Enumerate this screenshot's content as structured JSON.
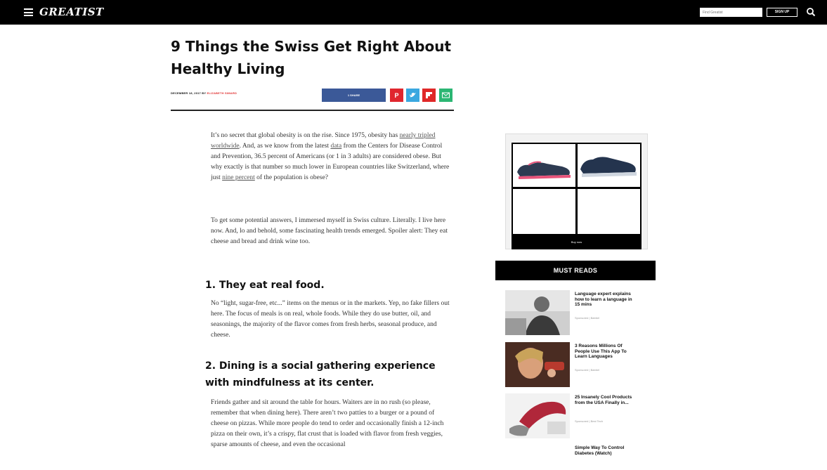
{
  "nav": {
    "logo": "GREATIST",
    "search_placeholder": "Find Greatist",
    "signup_label": "SIGN UP"
  },
  "article": {
    "title": "9 Things the Swiss Get Right About Healthy Living",
    "date": "DECEMBER 18, 2017",
    "by": "BY",
    "author": "ELIZABETH SIMARD",
    "share_label": "1 SHARE",
    "paragraphs": [
      {
        "before": "It’s no secret that global obesity is on the rise. Since 1975, obesity has ",
        "link1": "nearly tripled worldwide",
        "mid": ". And, as we know from the latest ",
        "link2": "data",
        "after": " from the Centers for Disease Control and Prevention, 36.5 percent of Americans (or 1 in 3 adults) are considered obese. But why exactly is that number so much lower in European countries like Switzerland, where just ",
        "link3": "nine percent",
        "end": " of the population is obese?"
      },
      {
        "text": "To get some potential answers, I immersed myself in Swiss culture. Literally. I live here now. And, lo and behold, some fascinating health trends emerged. Spoiler alert: They eat cheese and bread and drink wine too."
      }
    ],
    "sections": [
      {
        "heading": "1. They eat real food.",
        "body": "No “light, sugar-free, etc...” items on the menus or in the markets. Yep, no fake fillers out here. The focus of meals is on real, whole foods. While they do use butter, oil, and seasonings, the majority of the flavor comes from fresh herbs, seasonal produce, and cheese."
      },
      {
        "heading": "2. Dining is a social gathering experience with mindfulness at its center.",
        "body": "Friends gather and sit around the table for hours. Waiters are in no rush (so please, remember that when dining here). There aren’t two patties to a burger or a pound of cheese on pizzas. While more people do tend to order and occasionally finish a 12-inch pizza on their own, it’s a crispy, flat crust that is loaded with flavor from fresh veggies, sparse amounts of cheese, and even the occasional"
      }
    ]
  },
  "sidebar": {
    "must_reads_label": "MUST READS",
    "ad_footer": "Buy now",
    "items": [
      {
        "title": "Language expert explains how to learn a language in 15 mins",
        "sponsor": "Sponsored | Babbel"
      },
      {
        "title": "3 Reasons Millions Of People Use This App To Learn Languages",
        "sponsor": "Sponsored | Babbel"
      },
      {
        "title": "25 Insanely Cool Products from the USA Finally in...",
        "sponsor": "Sponsored | Best Tech"
      },
      {
        "title": "Simple Way To Control Diabetes (Watch)",
        "sponsor": ""
      }
    ]
  },
  "colors": {
    "facebook": "#3b5998",
    "pinterest": "#e0262e",
    "twitter": "#3aa8e0",
    "flipboard": "#e02828",
    "email": "#2bb673",
    "author": "#e03131"
  }
}
